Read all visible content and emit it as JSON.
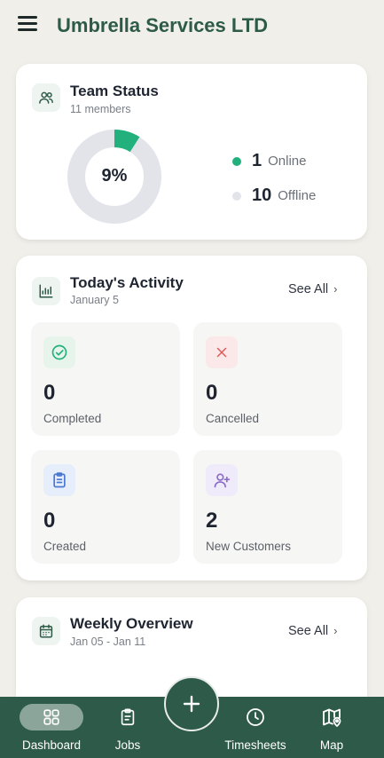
{
  "header": {
    "title": "Umbrella Services LTD"
  },
  "team_status": {
    "title": "Team Status",
    "subtitle": "11 members",
    "percent_label": "9%",
    "online_fraction": 0.09,
    "online_count": "1",
    "online_label": "Online",
    "offline_count": "10",
    "offline_label": "Offline"
  },
  "activity": {
    "title": "Today's Activity",
    "date": "January 5",
    "see_all": "See All",
    "tiles": [
      {
        "value": "0",
        "label": "Completed"
      },
      {
        "value": "0",
        "label": "Cancelled"
      },
      {
        "value": "0",
        "label": "Created"
      },
      {
        "value": "2",
        "label": "New Customers"
      }
    ]
  },
  "weekly": {
    "title": "Weekly Overview",
    "range": "Jan 05 - Jan 11",
    "see_all": "See All"
  },
  "nav": {
    "items": [
      {
        "label": "Dashboard",
        "icon": "grid-icon"
      },
      {
        "label": "Jobs",
        "icon": "clipboard-icon"
      },
      {
        "label": "Timesheets",
        "icon": "clock-icon"
      },
      {
        "label": "Map",
        "icon": "map-pin-icon"
      }
    ],
    "fab_icon": "plus-icon"
  },
  "colors": {
    "brand": "#2d5b47",
    "nav_bg": "#2e5a4a",
    "online": "#22b07d",
    "offline": "#e2e4ea"
  }
}
